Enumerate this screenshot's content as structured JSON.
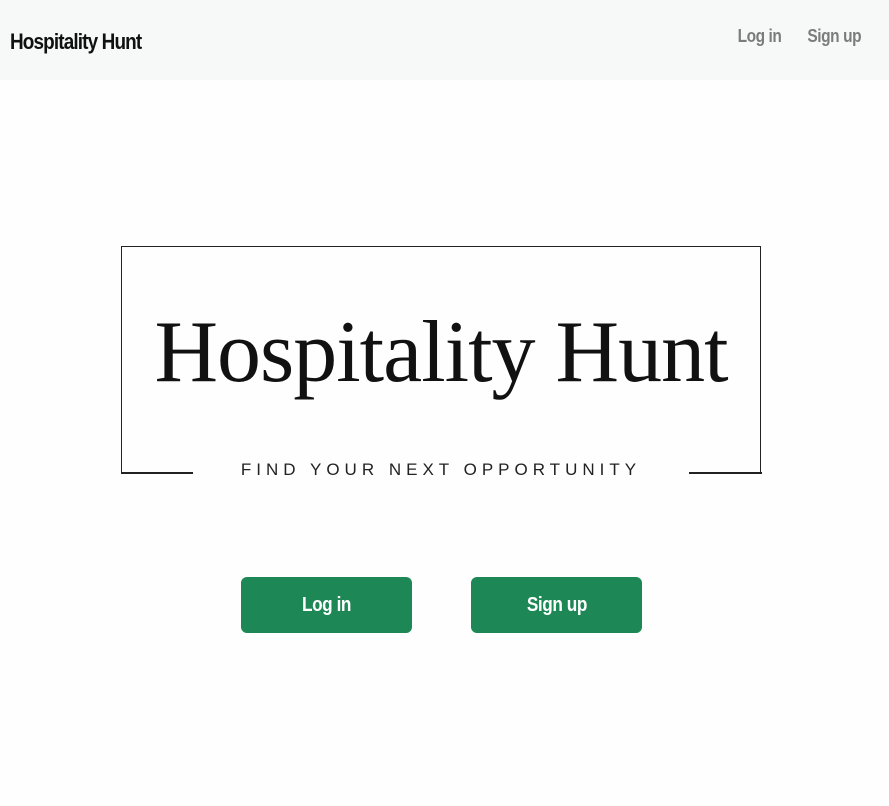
{
  "navbar": {
    "brand": "Hospitality Hunt",
    "links": [
      {
        "label": "Log in"
      },
      {
        "label": "Sign up"
      }
    ]
  },
  "hero": {
    "logo_title": "Hospitality Hunt",
    "logo_tagline": "FIND YOUR NEXT OPPORTUNITY"
  },
  "actions": {
    "login_label": "Log in",
    "signup_label": "Sign up"
  },
  "colors": {
    "accent": "#1d8756",
    "navbar_bg": "#f7f9f8",
    "nav_link": "#7b7d7c"
  }
}
